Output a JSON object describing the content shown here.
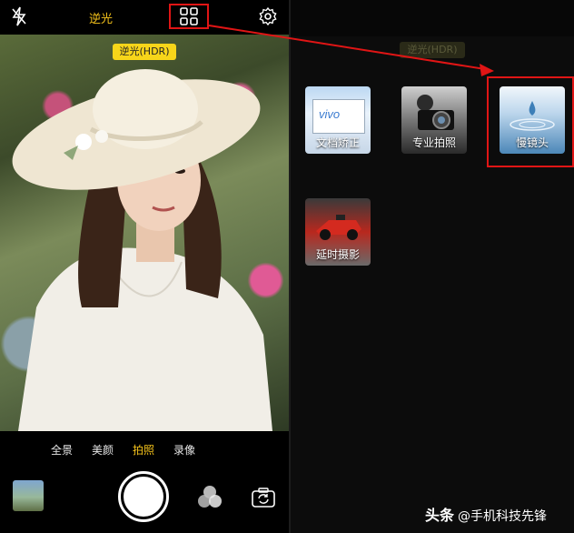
{
  "left": {
    "top_bar": {
      "flash": "flash-off-icon",
      "hdr_label": "逆光",
      "modes_grid": "grid-icon",
      "settings": "gear-icon"
    },
    "hdr_badge": "逆光(HDR)",
    "modes": [
      {
        "label": "全景",
        "active": false
      },
      {
        "label": "美颜",
        "active": false
      },
      {
        "label": "拍照",
        "active": true
      },
      {
        "label": "录像",
        "active": false
      }
    ]
  },
  "right": {
    "hdr_badge": "逆光(HDR)",
    "tiles": [
      {
        "label": "文档矫正",
        "icon": "document-correction-icon",
        "logo": "vivo"
      },
      {
        "label": "专业拍照",
        "icon": "pro-camera-icon"
      },
      {
        "label": "慢镜头",
        "icon": "slow-motion-icon"
      },
      {
        "label": "延时摄影",
        "icon": "timelapse-icon"
      }
    ]
  },
  "watermark": {
    "brand": "头条",
    "handle": "@手机科技先锋"
  },
  "colors": {
    "accent": "#f4c21b",
    "highlight": "#e01515"
  }
}
